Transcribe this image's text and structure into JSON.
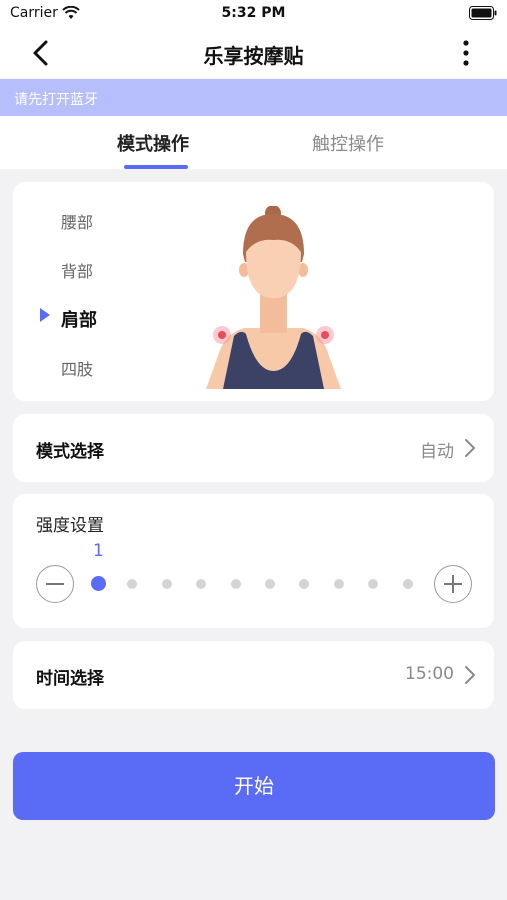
{
  "status_bar": {
    "carrier": "Carrier",
    "time": "5:32 PM"
  },
  "nav": {
    "title": "乐享按摩贴"
  },
  "banner": {
    "text": "请先打开蓝牙"
  },
  "tabs": [
    {
      "label": "模式操作",
      "selected": true
    },
    {
      "label": "触控操作",
      "selected": false
    }
  ],
  "body_parts": {
    "items": [
      {
        "label": "腰部"
      },
      {
        "label": "背部"
      },
      {
        "label": "肩部"
      },
      {
        "label": "四肢"
      }
    ],
    "selected": "肩部"
  },
  "mode_row": {
    "label": "模式选择",
    "value": "自动"
  },
  "intensity": {
    "label": "强度设置",
    "value": "1",
    "level": 1,
    "max": 10
  },
  "time_row": {
    "label": "时间选择",
    "value": "15:00"
  },
  "start_button": {
    "label": "开始"
  },
  "colors": {
    "accent": "#5a6cf6",
    "banner": "#b6bffb",
    "background": "#f2f2f5"
  },
  "icons": [
    "wifi-icon",
    "battery-icon",
    "back-chevron-icon",
    "more-vertical-icon",
    "chevron-right-icon",
    "minus-icon",
    "plus-icon",
    "triangle-marker-icon"
  ]
}
